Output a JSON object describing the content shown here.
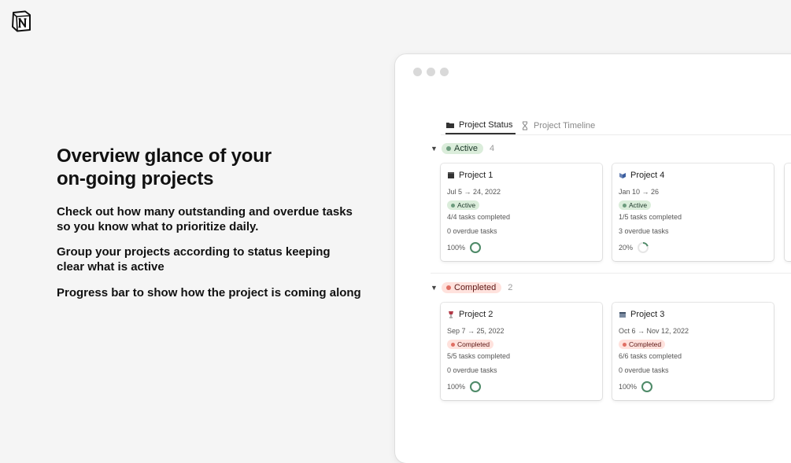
{
  "logo": {
    "icon": "notion-logo-icon"
  },
  "hero": {
    "title": "Overview glance of your\non-going projects",
    "bullets": [
      "Check out how many outstanding and overdue tasks\nso you know what to prioritize daily.",
      "Group your projects according to status keeping\nclear what is active",
      "Progress bar to show how the project is coming along"
    ]
  },
  "window": {
    "tabs": [
      {
        "label": "Project Status",
        "icon": "folder-icon",
        "active": true
      },
      {
        "label": "Project Timeline",
        "icon": "hourglass-icon",
        "active": false
      }
    ],
    "groups": [
      {
        "status": "Active",
        "count": "4",
        "cards": [
          {
            "title": "Project 1",
            "icon": "clapper-icon",
            "dates": "Jul 5 → 24, 2022",
            "status": "Active",
            "tasks": "4/4 tasks completed",
            "overdue": "0 overdue tasks",
            "progress_label": "100%",
            "progress": 1.0
          },
          {
            "title": "Project 4",
            "icon": "dossier-icon",
            "dates": "Jan 10 → 26",
            "status": "Active",
            "tasks": "1/5 tasks completed",
            "overdue": "3 overdue tasks",
            "progress_label": "20%",
            "progress": 0.2
          }
        ]
      },
      {
        "status": "Completed",
        "count": "2",
        "cards": [
          {
            "title": "Project 2",
            "icon": "wine-glass-icon",
            "dates": "Sep 7 → 25, 2022",
            "status": "Completed",
            "tasks": "5/5 tasks completed",
            "overdue": "0 overdue tasks",
            "progress_label": "100%",
            "progress": 1.0
          },
          {
            "title": "Project 3",
            "icon": "calendar-icon",
            "dates": "Oct 6 → Nov 12, 2022",
            "status": "Completed",
            "tasks": "6/6 tasks completed",
            "overdue": "0 overdue tasks",
            "progress_label": "100%",
            "progress": 1.0
          }
        ]
      }
    ]
  },
  "colors": {
    "background": "#f5f5f5",
    "active_pill_bg": "#dbeddb",
    "active_dot": "#6c9b7d",
    "completed_pill_bg": "#ffe2dd",
    "completed_dot": "#e16f64",
    "progress_ring": "#4e8a68"
  }
}
